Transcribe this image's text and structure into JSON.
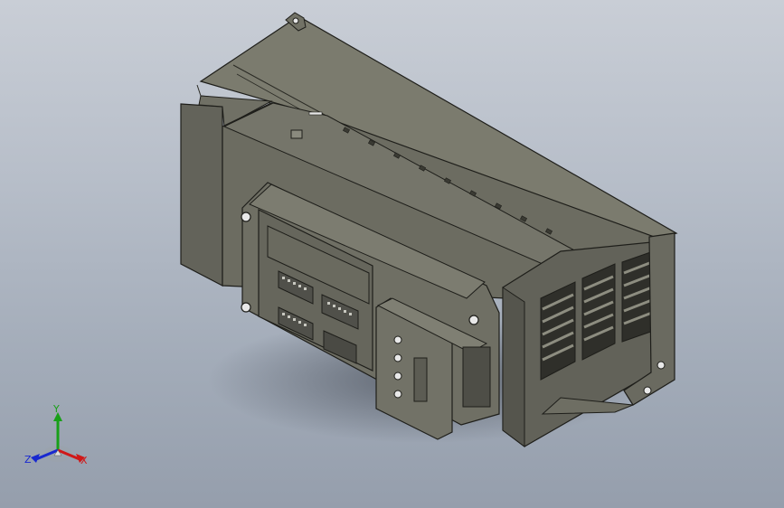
{
  "viewport": {
    "background_top": "#c9ced6",
    "background_bottom": "#959eac",
    "model_name": "industrial-controller-housing",
    "model_color": "#6e6e62"
  },
  "triad": {
    "x_label": "X",
    "y_label": "Y",
    "z_label": "Z",
    "x_color": "#d01818",
    "y_color": "#18a018",
    "z_color": "#1828d0"
  }
}
